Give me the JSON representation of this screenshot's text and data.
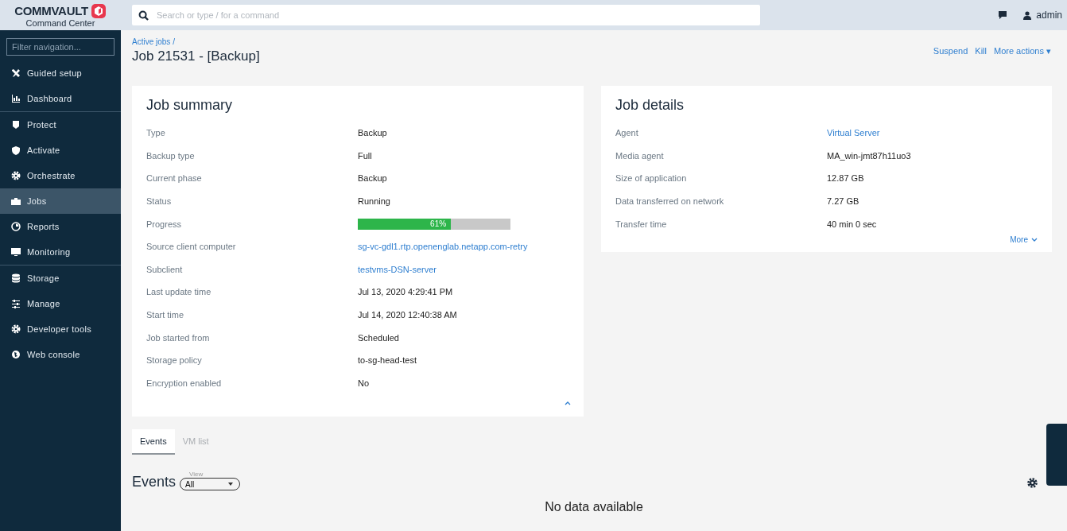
{
  "logo": {
    "brand": "COMMVAULT",
    "product": "Command Center"
  },
  "search": {
    "placeholder": "Search or type / for a command"
  },
  "user": {
    "name": "admin"
  },
  "sidebar": {
    "filter_placeholder": "Filter navigation...",
    "items": [
      {
        "label": "Guided setup",
        "selected": false,
        "divider_after": false
      },
      {
        "label": "Dashboard",
        "selected": false,
        "divider_after": true
      },
      {
        "label": "Protect",
        "selected": false,
        "divider_after": false
      },
      {
        "label": "Activate",
        "selected": false,
        "divider_after": false
      },
      {
        "label": "Orchestrate",
        "selected": false,
        "divider_after": false
      },
      {
        "label": "Jobs",
        "selected": true,
        "divider_after": false
      },
      {
        "label": "Reports",
        "selected": false,
        "divider_after": false
      },
      {
        "label": "Monitoring",
        "selected": false,
        "divider_after": true
      },
      {
        "label": "Storage",
        "selected": false,
        "divider_after": false
      },
      {
        "label": "Manage",
        "selected": false,
        "divider_after": false
      },
      {
        "label": "Developer tools",
        "selected": false,
        "divider_after": false
      },
      {
        "label": "Web console",
        "selected": false,
        "divider_after": false
      }
    ]
  },
  "breadcrumb": "Active jobs /",
  "page_title": "Job 21531 - [Backup]",
  "actions": [
    "Suspend",
    "Kill",
    "More actions ▾"
  ],
  "job_summary": {
    "title": "Job summary",
    "rows": [
      {
        "label": "Type",
        "value": "Backup",
        "kind": "text"
      },
      {
        "label": "Backup type",
        "value": "Full",
        "kind": "text"
      },
      {
        "label": "Current phase",
        "value": "Backup",
        "kind": "text"
      },
      {
        "label": "Status",
        "value": "Running",
        "kind": "text"
      },
      {
        "label": "Progress",
        "value": "61%",
        "kind": "progress",
        "level": 0.61
      },
      {
        "label": "Source client computer",
        "value": "sg-vc-gdl1.rtp.openenglab.netapp.com-retry",
        "kind": "link"
      },
      {
        "label": "Subclient",
        "value": "testvms-DSN-server",
        "kind": "link"
      },
      {
        "label": "Last update time",
        "value": "Jul 13, 2020 4:29:41 PM",
        "kind": "text"
      },
      {
        "label": "Start time",
        "value": "Jul 14, 2020 12:40:38 AM",
        "kind": "text"
      },
      {
        "label": "Job started from",
        "value": "Scheduled",
        "kind": "text"
      },
      {
        "label": "Storage policy",
        "value": "to-sg-head-test",
        "kind": "text"
      },
      {
        "label": "Encryption enabled",
        "value": "No",
        "kind": "text"
      }
    ]
  },
  "job_details": {
    "title": "Job details",
    "more": "More",
    "rows": [
      {
        "label": "Agent",
        "value": "Virtual Server",
        "kind": "link"
      },
      {
        "label": "Media agent",
        "value": "MA_win-jmt87h11uo3",
        "kind": "text"
      },
      {
        "label": "Size of application",
        "value": "12.87 GB",
        "kind": "text"
      },
      {
        "label": "Data transferred on network",
        "value": "7.27 GB",
        "kind": "text"
      },
      {
        "label": "Transfer time",
        "value": "40 min 0 sec",
        "kind": "text"
      }
    ]
  },
  "tabs": [
    {
      "label": "Events",
      "selected": true
    },
    {
      "label": "VM list",
      "selected": false
    }
  ],
  "events": {
    "title": "Events",
    "view_label": "View",
    "view_value": "All",
    "empty": "No data available"
  }
}
